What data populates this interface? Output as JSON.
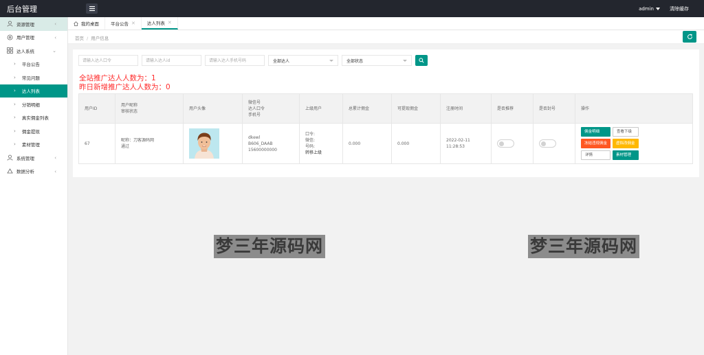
{
  "header": {
    "title": "后台管理",
    "user": "admin",
    "clear_cache": "清除缓存"
  },
  "sidebar": {
    "items": [
      {
        "label": "资源管理",
        "icon": "user-icon",
        "arrow": "‹"
      },
      {
        "label": "用户管理",
        "icon": "settings-icon",
        "arrow": "‹"
      },
      {
        "label": "达人系统",
        "icon": "grid-icon",
        "arrow": "⌄"
      },
      {
        "label": "平台公告"
      },
      {
        "label": "常见问题"
      },
      {
        "label": "达人列表"
      },
      {
        "label": "分销明细"
      },
      {
        "label": "真实佣金列表"
      },
      {
        "label": "佣金提现"
      },
      {
        "label": "素材管理"
      },
      {
        "label": "系统管理",
        "icon": "user-icon",
        "arrow": "‹"
      },
      {
        "label": "数据分析",
        "icon": "recycle-icon",
        "arrow": "‹"
      }
    ]
  },
  "tabs": [
    {
      "label": "我的桌面"
    },
    {
      "label": "平台公告"
    },
    {
      "label": "达人列表"
    }
  ],
  "breadcrumb": {
    "home": "首页",
    "sep": "/",
    "current": "用户信息"
  },
  "filters": {
    "code_placeholder": "请输入达人口令",
    "id_placeholder": "请输入达人id",
    "phone_placeholder": "请输入达人手机号码",
    "type_select": "全部达人",
    "status_select": "全部状态"
  },
  "stats": {
    "total": "全站推广达人人数为：1",
    "yesterday": "昨日新增推广达人人数为：0"
  },
  "table": {
    "headers": {
      "id": "用户ID",
      "nick": "用户昵称",
      "audit": "审核状态",
      "avatar": "用户头像",
      "wechat": "微信号",
      "code": "达人口令",
      "phone": "手机号",
      "parent": "上级用户",
      "total": "总累计佣金",
      "withdrawable": "可提现佣金",
      "reg_time": "注册时间",
      "recommend": "是否推荐",
      "banned": "是否封号",
      "ops": "操作"
    },
    "row": {
      "id": "67",
      "nick": "昵称：刀客源码网",
      "audit": "通过",
      "wechat": "dkewl",
      "code": "B606_DAAB",
      "phone": "15600000000",
      "parent_code": "口令:",
      "parent_wechat": "微信:",
      "parent_number": "号码:",
      "transfer": "转移上级",
      "total": "0.000",
      "withdrawable": "0.000",
      "reg_date": "2022-02-11",
      "reg_clock": "11:28:53",
      "recommend_on": false,
      "banned_on": false
    },
    "buttons": {
      "commission_detail": "佣金明细",
      "view_sub": "查看下级",
      "freeze_commission": "冻结违规佣金",
      "virtual_commission": "虚拟改佣金",
      "detail": "详情",
      "material": "素材管理"
    }
  },
  "watermark": {
    "text": "梦三年源码网"
  },
  "colors": {
    "primary": "#009688",
    "header_bg": "#23262e",
    "stat_red": "#ff2d2d",
    "btn_red": "#ff5722",
    "btn_orange": "#ffb800"
  }
}
